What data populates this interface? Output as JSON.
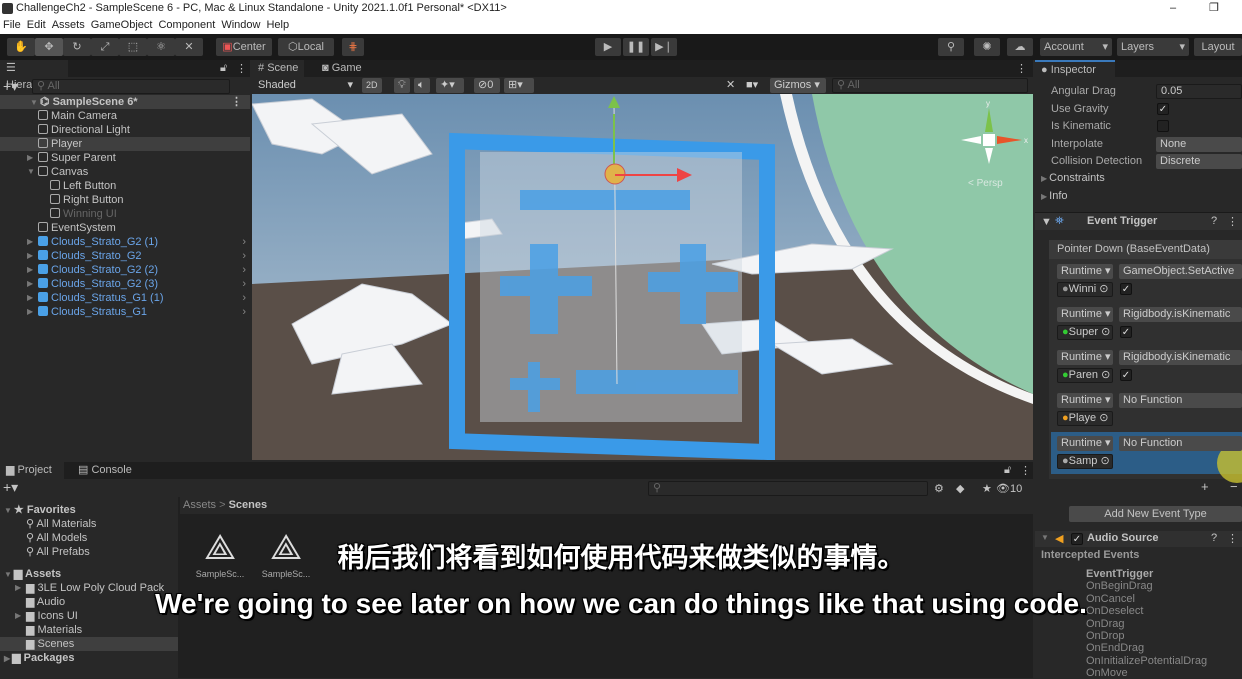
{
  "window": {
    "title": "ChallengeCh2 - SampleScene 6 - PC, Mac & Linux Standalone - Unity 2021.1.0f1 Personal* <DX11>",
    "minimize": "–",
    "restore": "❐"
  },
  "menu": [
    "File",
    "Edit",
    "Assets",
    "GameObject",
    "Component",
    "Window",
    "Help"
  ],
  "toolbar": {
    "tools": [
      "hand-tool",
      "move-tool",
      "rotate-tool",
      "scale-tool",
      "rect-tool",
      "transform-tool",
      "custom-tool"
    ],
    "pivot": "Center",
    "space": "Local",
    "account": "Account",
    "layers": "Layers",
    "layout": "Layout"
  },
  "hierarchy": {
    "tab": "Hierarchy",
    "search_placeholder": "All",
    "scene": "SampleScene 6*",
    "items": [
      {
        "label": "Main Camera",
        "depth": 1,
        "type": "go"
      },
      {
        "label": "Directional Light",
        "depth": 1,
        "type": "go"
      },
      {
        "label": "Player",
        "depth": 1,
        "type": "go",
        "selected": true
      },
      {
        "label": "Super Parent",
        "depth": 1,
        "type": "go",
        "expandable": true
      },
      {
        "label": "Canvas",
        "depth": 1,
        "type": "go",
        "expanded": true
      },
      {
        "label": "Left Button",
        "depth": 2,
        "type": "go"
      },
      {
        "label": "Right Button",
        "depth": 2,
        "type": "go"
      },
      {
        "label": "Winning UI",
        "depth": 2,
        "type": "go",
        "inactive": true
      },
      {
        "label": "EventSystem",
        "depth": 1,
        "type": "go"
      },
      {
        "label": "Clouds_Strato_G2 (1)",
        "depth": 1,
        "type": "prefab"
      },
      {
        "label": "Clouds_Strato_G2",
        "depth": 1,
        "type": "prefab"
      },
      {
        "label": "Clouds_Strato_G2 (2)",
        "depth": 1,
        "type": "prefab"
      },
      {
        "label": "Clouds_Strato_G2 (3)",
        "depth": 1,
        "type": "prefab"
      },
      {
        "label": "Clouds_Stratus_G1 (1)",
        "depth": 1,
        "type": "prefab"
      },
      {
        "label": "Clouds_Stratus_G1",
        "depth": 1,
        "type": "prefab"
      }
    ]
  },
  "scene": {
    "tabs": [
      "Scene",
      "Game"
    ],
    "shading": "Shaded",
    "mode2d": "2D",
    "hidden_count": "0",
    "gizmos": "Gizmos",
    "search_placeholder": "All",
    "persp": "< Persp",
    "axis_y": "y",
    "axis_x": "x"
  },
  "inspector": {
    "tab": "Inspector",
    "props": [
      {
        "label": "Angular Drag",
        "value": "0.05"
      },
      {
        "label": "Use Gravity",
        "checked": true
      },
      {
        "label": "Is Kinematic",
        "checked": false
      },
      {
        "label": "Interpolate",
        "value": "None"
      },
      {
        "label": "Collision Detection",
        "value": "Discrete"
      }
    ],
    "foldouts": [
      "Constraints",
      "Info"
    ],
    "event_trigger": {
      "title": "Event Trigger",
      "event": "Pointer Down (BaseEventData)",
      "entries": [
        {
          "mode": "Runtime",
          "function": "GameObject.SetActive",
          "target": "Winni",
          "checked": true
        },
        {
          "mode": "Runtime",
          "function": "Rigidbody.isKinematic",
          "target": "Super",
          "checked": true
        },
        {
          "mode": "Runtime",
          "function": "Rigidbody.isKinematic",
          "target": "Paren",
          "checked": true
        },
        {
          "mode": "Runtime",
          "function": "No Function",
          "target": "Playe"
        },
        {
          "mode": "Runtime",
          "function": "No Function",
          "target": "Samp",
          "selected": true
        }
      ],
      "add": "+",
      "remove": "−",
      "add_event": "Add New Event Type"
    },
    "audio_source": {
      "title": "Audio Source",
      "enabled": true
    },
    "intercepted": {
      "title": "Intercepted Events",
      "items": [
        "EventTrigger",
        "OnBeginDrag",
        "OnCancel",
        "OnDeselect",
        "OnDrag",
        "OnDrop",
        "OnEndDrag",
        "OnInitializePotentialDrag",
        "OnMove"
      ]
    }
  },
  "project": {
    "tabs": [
      "Project",
      "Console"
    ],
    "favorites": "Favorites",
    "fav_items": [
      "All Materials",
      "All Models",
      "All Prefabs"
    ],
    "assets": "Assets",
    "asset_folders": [
      "3LE Low Poly Cloud Pack",
      "Audio",
      "Icons UI",
      "Materials",
      "Scenes"
    ],
    "packages": "Packages",
    "breadcrumb": [
      "Assets",
      "Scenes"
    ],
    "files": [
      "SampleSc...",
      "SampleSc..."
    ],
    "zoom_count": "10"
  },
  "subtitles": {
    "zh": "稍后我们将看到如何使用代码来做类似的事情。",
    "en": "We're going to see later on how we can do things like that using code."
  },
  "colors": {
    "accent": "#4aa0e6",
    "selection": "#2c5d87",
    "frame": "#3a9ae8"
  }
}
